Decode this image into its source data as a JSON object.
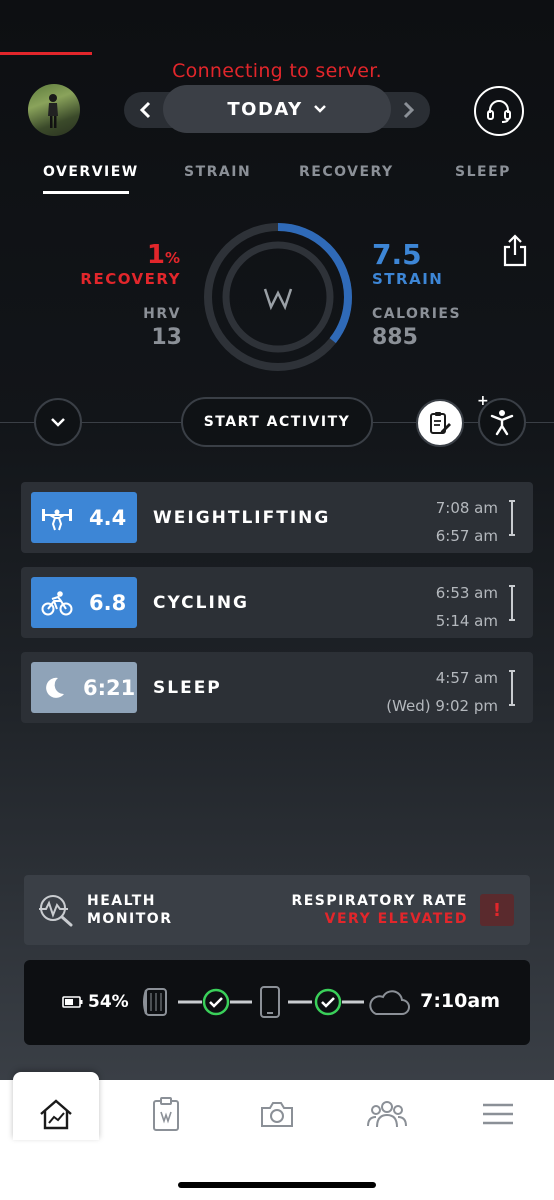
{
  "header": {
    "status_text": "Connecting to server.",
    "date_label": "TODAY"
  },
  "tabs": [
    {
      "label": "OVERVIEW",
      "active": true
    },
    {
      "label": "STRAIN",
      "active": false
    },
    {
      "label": "RECOVERY",
      "active": false
    },
    {
      "label": "SLEEP",
      "active": false
    }
  ],
  "overview": {
    "recovery_value": "1",
    "recovery_unit": "%",
    "recovery_label": "RECOVERY",
    "hrv_label": "HRV",
    "hrv_value": "13",
    "strain_value": "7.5",
    "strain_label": "STRAIN",
    "calories_label": "CALORIES",
    "calories_value": "885",
    "strain_fraction": 0.357,
    "colors": {
      "recovery": "#e2262b",
      "strain": "#3d86d6"
    }
  },
  "actions": {
    "start_activity_label": "START ACTIVITY",
    "plus": "+"
  },
  "activities": [
    {
      "type": "weightlifting-icon",
      "value": "4.4",
      "name": "WEIGHTLIFTING",
      "end": "7:08 am",
      "start": "6:57 am",
      "color": "#3d86d6"
    },
    {
      "type": "cycling-icon",
      "value": "6.8",
      "name": "CYCLING",
      "end": "6:53 am",
      "start": "5:14 am",
      "color": "#3d86d6"
    },
    {
      "type": "moon-icon",
      "value": "6:21",
      "name": "SLEEP",
      "end": "4:57 am",
      "start": "(Wed) 9:02 pm",
      "color": "#8fa3b8"
    }
  ],
  "health_monitor": {
    "title_line1": "HEALTH",
    "title_line2": "MONITOR",
    "metric_label": "RESPIRATORY RATE",
    "metric_status": "VERY ELEVATED",
    "alert_symbol": "!"
  },
  "sync": {
    "battery": "54%",
    "time": "7:10am"
  },
  "bottom_nav": [
    {
      "icon": "home-trend-icon",
      "active": true
    },
    {
      "icon": "journal-icon",
      "active": false
    },
    {
      "icon": "camera-icon",
      "active": false
    },
    {
      "icon": "community-icon",
      "active": false
    },
    {
      "icon": "menu-icon",
      "active": false
    }
  ]
}
